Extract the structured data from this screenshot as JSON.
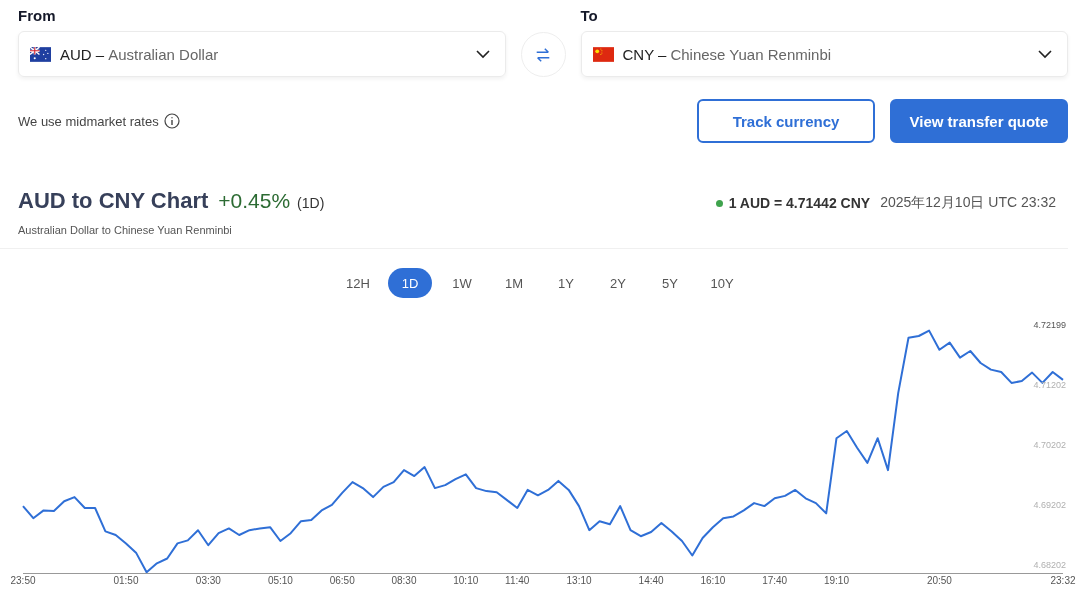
{
  "from": {
    "label": "From",
    "code": "AUD",
    "separator": "–",
    "name": "Australian Dollar"
  },
  "to": {
    "label": "To",
    "code": "CNY",
    "separator": "–",
    "name": "Chinese Yuan Renminbi"
  },
  "rates_note": "We use midmarket rates",
  "buttons": [
    {
      "label": "Track currency",
      "kind": "outline"
    },
    {
      "label": "View transfer quote",
      "kind": "primary"
    }
  ],
  "chart_header": {
    "title": "AUD to CNY Chart",
    "change": "+0.45%",
    "period": "(1D)",
    "subtitle": "Australian Dollar to Chinese Yuan Renminbi",
    "rate": "1 AUD = 4.71442 CNY",
    "timestamp": "2025年12月10日 UTC 23:32"
  },
  "periods": [
    {
      "label": "12H",
      "selected": false
    },
    {
      "label": "1D",
      "selected": true
    },
    {
      "label": "1W",
      "selected": false
    },
    {
      "label": "1M",
      "selected": false
    },
    {
      "label": "1Y",
      "selected": false
    },
    {
      "label": "2Y",
      "selected": false
    },
    {
      "label": "5Y",
      "selected": false
    },
    {
      "label": "10Y",
      "selected": false
    }
  ],
  "chart": {
    "chart_data": {
      "type": "line",
      "ylim": [
        4.6805,
        4.72199
      ],
      "categories": [
        "23:50",
        null,
        null,
        null,
        null,
        null,
        null,
        null,
        null,
        null,
        "01:50",
        null,
        null,
        null,
        null,
        null,
        null,
        null,
        "03:30",
        null,
        null,
        null,
        null,
        null,
        null,
        "05:10",
        null,
        null,
        null,
        null,
        null,
        "06:50",
        null,
        null,
        null,
        null,
        null,
        "08:30",
        null,
        null,
        null,
        null,
        null,
        "10:10",
        null,
        null,
        null,
        null,
        "11:40",
        null,
        null,
        null,
        null,
        null,
        "13:10",
        null,
        null,
        null,
        null,
        null,
        null,
        "14:40",
        null,
        null,
        null,
        null,
        null,
        "16:10",
        null,
        null,
        null,
        null,
        null,
        "17:40",
        null,
        null,
        null,
        null,
        null,
        "19:10",
        null,
        null,
        null,
        null,
        null,
        null,
        null,
        null,
        null,
        "20:50",
        null,
        null,
        null,
        null,
        null,
        null,
        null,
        null,
        null,
        null,
        null,
        "23:32"
      ],
      "yticks": [
        4.68202,
        4.69202,
        4.70202,
        4.71202,
        4.72199
      ],
      "series": [
        {
          "color": "#2f6fd6",
          "values": [
            4.6917,
            4.6897,
            4.691,
            4.6909,
            4.6925,
            4.6932,
            4.6914,
            4.6914,
            4.6875,
            4.6869,
            4.6855,
            4.6839,
            4.6807,
            4.6822,
            4.683,
            4.6855,
            4.686,
            4.6877,
            4.6852,
            4.6872,
            4.688,
            4.6869,
            4.6877,
            4.688,
            4.6882,
            4.6859,
            4.6872,
            4.6892,
            4.6894,
            4.691,
            4.6919,
            4.6939,
            4.6957,
            4.6947,
            4.6932,
            4.6949,
            4.6957,
            4.6977,
            4.6967,
            4.6982,
            4.6947,
            4.6952,
            4.6962,
            4.697,
            4.6947,
            4.6942,
            4.694,
            4.6927,
            4.6914,
            4.6944,
            4.6935,
            4.6944,
            4.6959,
            4.6944,
            4.6917,
            4.6877,
            4.6892,
            4.6887,
            4.6917,
            4.6877,
            4.6867,
            4.6874,
            4.6889,
            4.6875,
            4.6859,
            4.6835,
            4.6864,
            4.6882,
            4.6897,
            4.69,
            4.691,
            4.6922,
            4.6917,
            4.693,
            4.6934,
            4.6944,
            4.693,
            4.6922,
            4.6905,
            4.703,
            4.7042,
            4.7014,
            4.6989,
            4.703,
            4.6977,
            4.7105,
            4.7197,
            4.72,
            4.7209,
            4.7177,
            4.7189,
            4.7164,
            4.7175,
            4.7155,
            4.7144,
            4.714,
            4.7122,
            4.7125,
            4.7139,
            4.7122,
            4.714,
            4.7127
          ]
        }
      ]
    }
  }
}
